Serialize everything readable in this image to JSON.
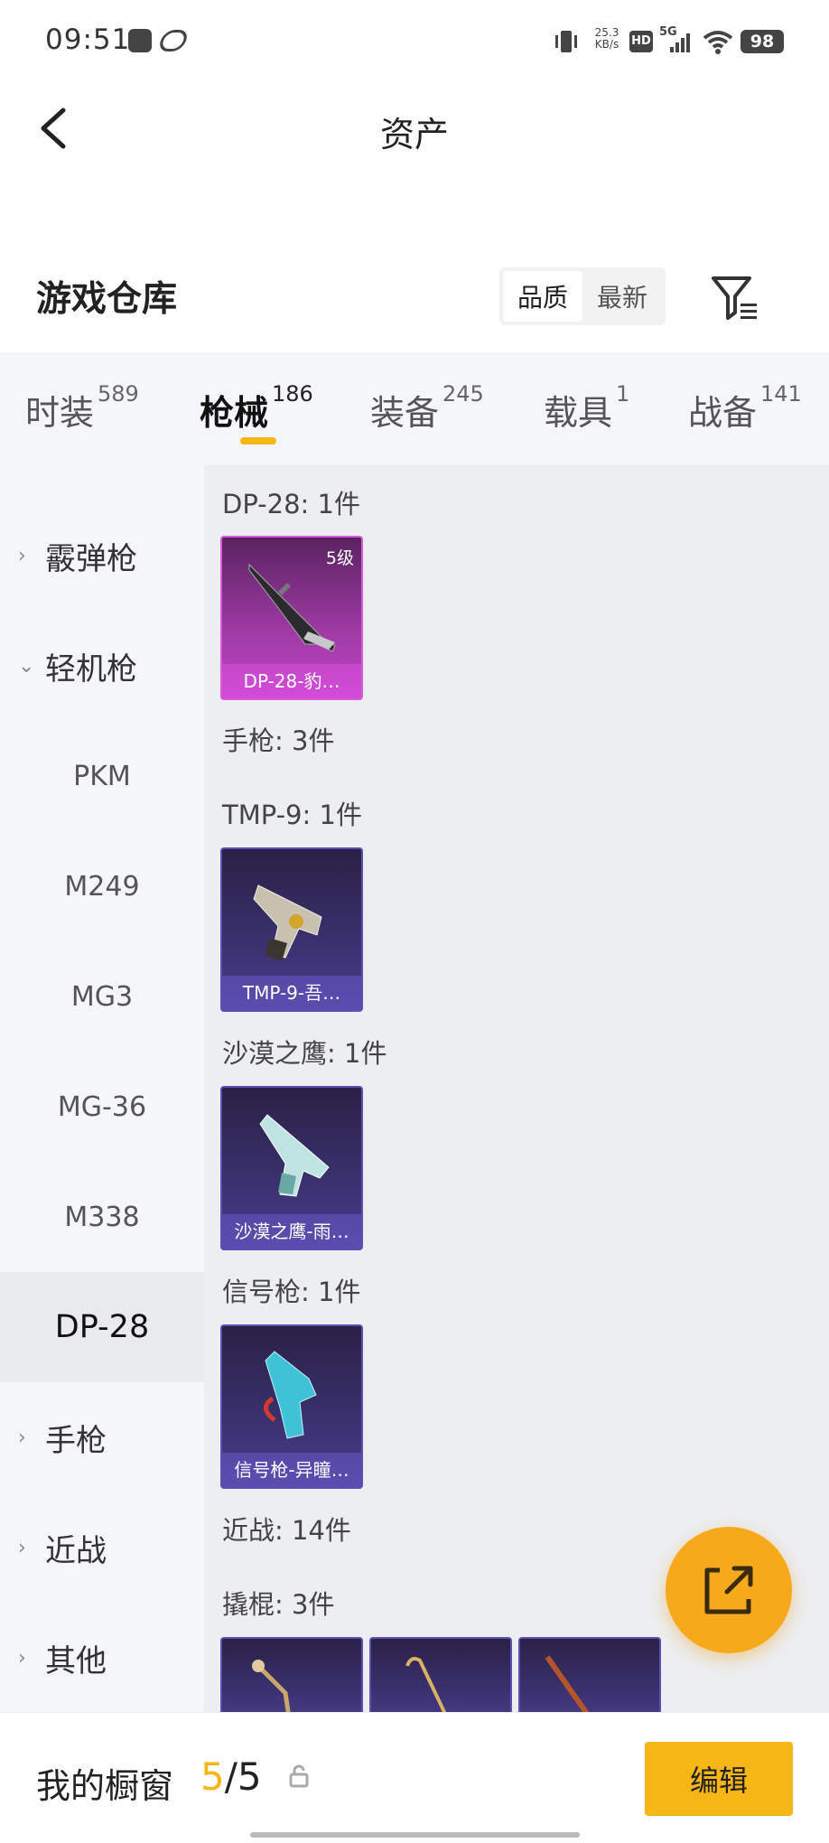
{
  "status_bar": {
    "time": "09:51",
    "net_speed_value": "25.3",
    "net_speed_unit": "KB/s",
    "hd_label": "HD",
    "signal_label": "5G",
    "battery": "98"
  },
  "header": {
    "title": "资产"
  },
  "warehouse": {
    "title": "游戏仓库",
    "sort_options": [
      "品质",
      "最新"
    ],
    "active_sort": "品质"
  },
  "tabs": [
    {
      "label": "时装",
      "count": "589"
    },
    {
      "label": "枪械",
      "count": "186"
    },
    {
      "label": "装备",
      "count": "245"
    },
    {
      "label": "载具",
      "count": "1"
    },
    {
      "label": "战备",
      "count": "141"
    }
  ],
  "active_tab": "枪械",
  "sidebar": {
    "items": [
      {
        "label": "霰弹枪",
        "type": "category",
        "expanded": false
      },
      {
        "label": "轻机枪",
        "type": "category",
        "expanded": true
      },
      {
        "label": "PKM",
        "type": "sub"
      },
      {
        "label": "M249",
        "type": "sub"
      },
      {
        "label": "MG3",
        "type": "sub"
      },
      {
        "label": "MG-36",
        "type": "sub"
      },
      {
        "label": "M338",
        "type": "sub"
      },
      {
        "label": "DP-28",
        "type": "sub",
        "selected": true
      },
      {
        "label": "手枪",
        "type": "category",
        "expanded": false
      },
      {
        "label": "近战",
        "type": "category",
        "expanded": false
      },
      {
        "label": "其他",
        "type": "category",
        "expanded": false
      }
    ]
  },
  "content": {
    "groups": [
      {
        "title": "DP-28: 1件"
      },
      {
        "title": "手枪: 3件"
      },
      {
        "title": "TMP-9: 1件"
      },
      {
        "title": "沙漠之鹰: 1件"
      },
      {
        "title": "信号枪: 1件"
      },
      {
        "title": "近战: 14件"
      },
      {
        "title": "撬棍: 3件"
      }
    ],
    "cards": [
      {
        "label": "DP-28-豹…",
        "level": "5级",
        "rarity": "pink"
      },
      {
        "label": "TMP-9-吾…",
        "rarity": "blue"
      },
      {
        "label": "沙漠之鹰-雨…",
        "rarity": "blue"
      },
      {
        "label": "信号枪-异瞳…",
        "rarity": "blue"
      }
    ]
  },
  "bottom_bar": {
    "title": "我的橱窗",
    "current": "5",
    "separator": "/",
    "total": "5",
    "edit_label": "编辑"
  },
  "colors": {
    "accent": "#f6b615",
    "fab": "#f6a91a",
    "rarity_pink": "#c244c9",
    "rarity_blue": "#4a3e8a"
  }
}
